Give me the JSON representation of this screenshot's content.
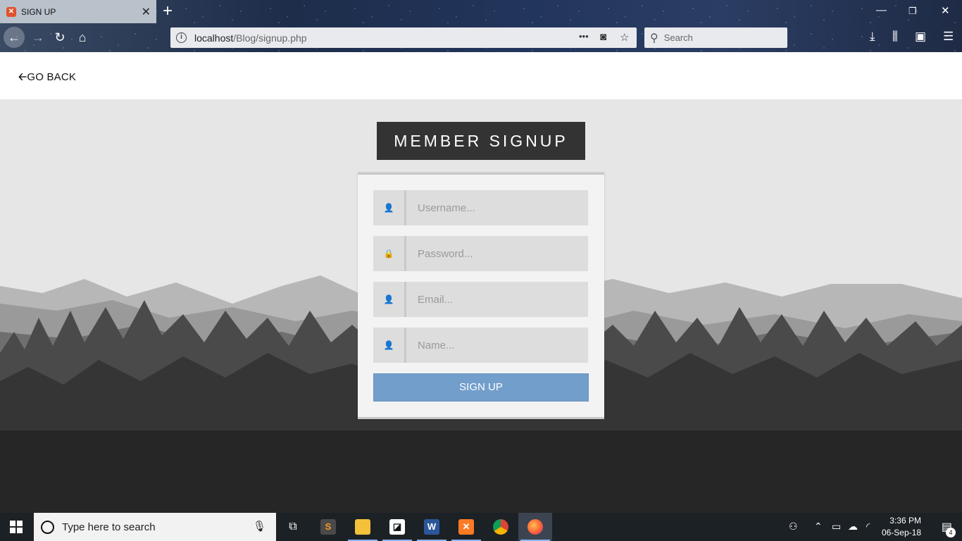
{
  "browser": {
    "tab_title": "SIGN UP",
    "tab_favicon": "xampp-favicon",
    "url_host": "localhost",
    "url_path": "/Blog/signup.php",
    "search_placeholder": "Search",
    "page_actions": "•••"
  },
  "page": {
    "go_back_label": "GO BACK",
    "heading": "MEMBER SIGNUP",
    "fields": [
      {
        "placeholder": "Username...",
        "icon": "user-icon"
      },
      {
        "placeholder": "Password...",
        "icon": "lock-icon"
      },
      {
        "placeholder": "Email...",
        "icon": "user-icon"
      },
      {
        "placeholder": "Name...",
        "icon": "user-icon"
      }
    ],
    "submit_label": "SIGN UP",
    "colors": {
      "heading_bg": "#333333",
      "button_bg": "#729ecb",
      "card_bg": "#f3f3f3"
    }
  },
  "taskbar": {
    "search_placeholder": "Type here to search",
    "apps": [
      "task-view",
      "sublime-text",
      "file-explorer",
      "sticky-notes",
      "word",
      "xampp",
      "chrome",
      "firefox"
    ],
    "time": "3:36 PM",
    "date": "06-Sep-18",
    "notification_count": "4"
  }
}
